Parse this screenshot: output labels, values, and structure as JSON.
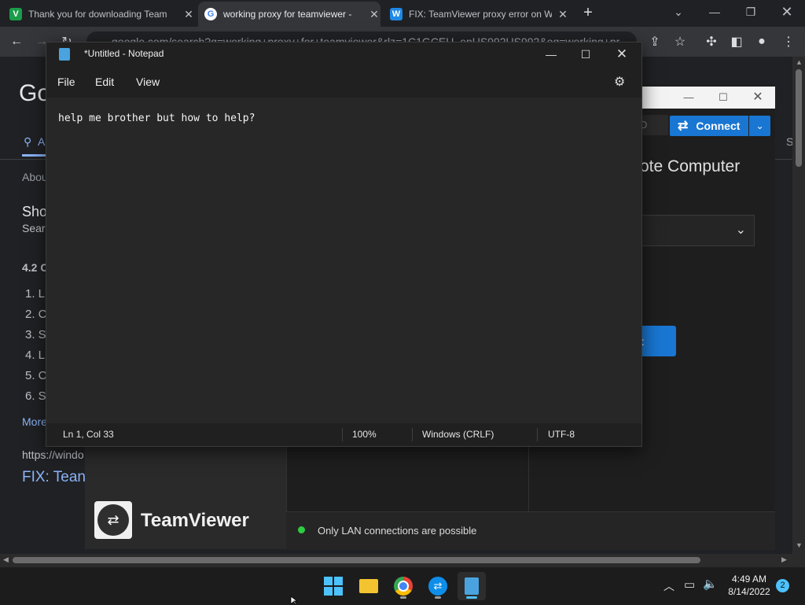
{
  "browser": {
    "tabs": [
      {
        "title": "Thank you for downloading Team",
        "favicon": "V",
        "favicon_color": "#1a9c4a"
      },
      {
        "title": "working proxy for teamviewer -",
        "favicon": "G",
        "favicon_color": "#4285f4"
      },
      {
        "title": "FIX: TeamViewer proxy error on W",
        "favicon": "W",
        "favicon_color": "#1e88e5"
      }
    ],
    "new_tab": "+",
    "url": "google.com/search?q=working+proxy+for+teamviewer&rlz=1C1GCEU_enUS992US992&oq=working+pr"
  },
  "search_page": {
    "logo_fragment": "Go",
    "tab_all_fragment": "A",
    "about": "Abou",
    "heading": "Sho",
    "sub": "Sear",
    "rating": "4.2 C",
    "list": [
      "1. L",
      "2. C",
      "3. S",
      "4. L",
      "5. C",
      "6. S"
    ],
    "more": "More",
    "url_fragment": "https://windo",
    "result_title": "FIX: Tean",
    "right_tab": "S"
  },
  "teamviewer": {
    "id_fragment": "D",
    "connect_label": "Connect",
    "heading_fragment": "ote Computer",
    "button_fragment": "t",
    "brand": "TeamViewer",
    "status": "Only LAN connections are possible",
    "status_color": "#2ecc40"
  },
  "notepad": {
    "title": "*Untitled - Notepad",
    "menu": [
      "File",
      "Edit",
      "View"
    ],
    "content": "help me brother but how to help?",
    "status": {
      "position": "Ln 1, Col 33",
      "zoom": "100%",
      "line_ending": "Windows (CRLF)",
      "encoding": "UTF-8"
    }
  },
  "taskbar": {
    "time": "4:49 AM",
    "date": "8/14/2022",
    "notifications": "2"
  }
}
